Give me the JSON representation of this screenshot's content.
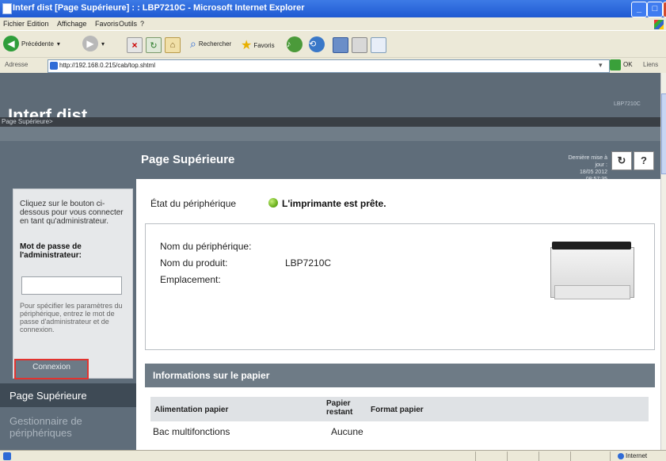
{
  "window": {
    "title": "Interf dist [Page Supérieure] : : LBP7210C - Microsoft Internet Explorer",
    "min": "_",
    "max": "□"
  },
  "menu": [
    "Fichier",
    "Edition",
    "Affichage",
    "Favoris",
    "Outils",
    "?"
  ],
  "toolbar": {
    "back_label": "Précédente",
    "search_label": "Rechercher",
    "favorites_label": "Favoris"
  },
  "address": {
    "label": "Adresse",
    "url": "http://192.168.0.215/cab/top.shtml",
    "go_label": "OK",
    "links_label": "Liens"
  },
  "header": {
    "brand": "Interf dist",
    "model": "LBP7210C",
    "breadcrumb": "Page Supérieure>"
  },
  "page": {
    "title": "Page Supérieure",
    "last_update_label": "Dernière mise à jour :",
    "last_update_value": "18/05 2012 08:57:35",
    "refresh_icon": "↻",
    "help_icon": "?"
  },
  "login": {
    "intro": "Cliquez sur le bouton ci-dessous pour vous connecter en tant qu'administrateur.",
    "password_label": "Mot de passe de l'administrateur:",
    "hint": "Pour spécifier les paramètres du périphérique, entrez le mot de passe d'administrateur et de connexion.",
    "button": "Connexion"
  },
  "nav": {
    "active": "Page Supérieure",
    "device_manager": "Gestionnaire de périphériques"
  },
  "status": {
    "label": "État du périphérique",
    "message": "L'imprimante est prête.",
    "color": "#6db21f"
  },
  "device": {
    "name_label": "Nom du périphérique:",
    "name_value": "",
    "product_label": "Nom du produit:",
    "product_value": "LBP7210C",
    "location_label": "Emplacement:",
    "location_value": ""
  },
  "paper": {
    "heading": "Informations sur le papier",
    "columns": [
      "Alimentation papier",
      "Papier restant",
      "Format papier"
    ],
    "rows": [
      {
        "source": "Bac multifonctions",
        "remaining": "Aucune",
        "size": ""
      }
    ]
  },
  "statusbar": {
    "zone": "Internet"
  }
}
